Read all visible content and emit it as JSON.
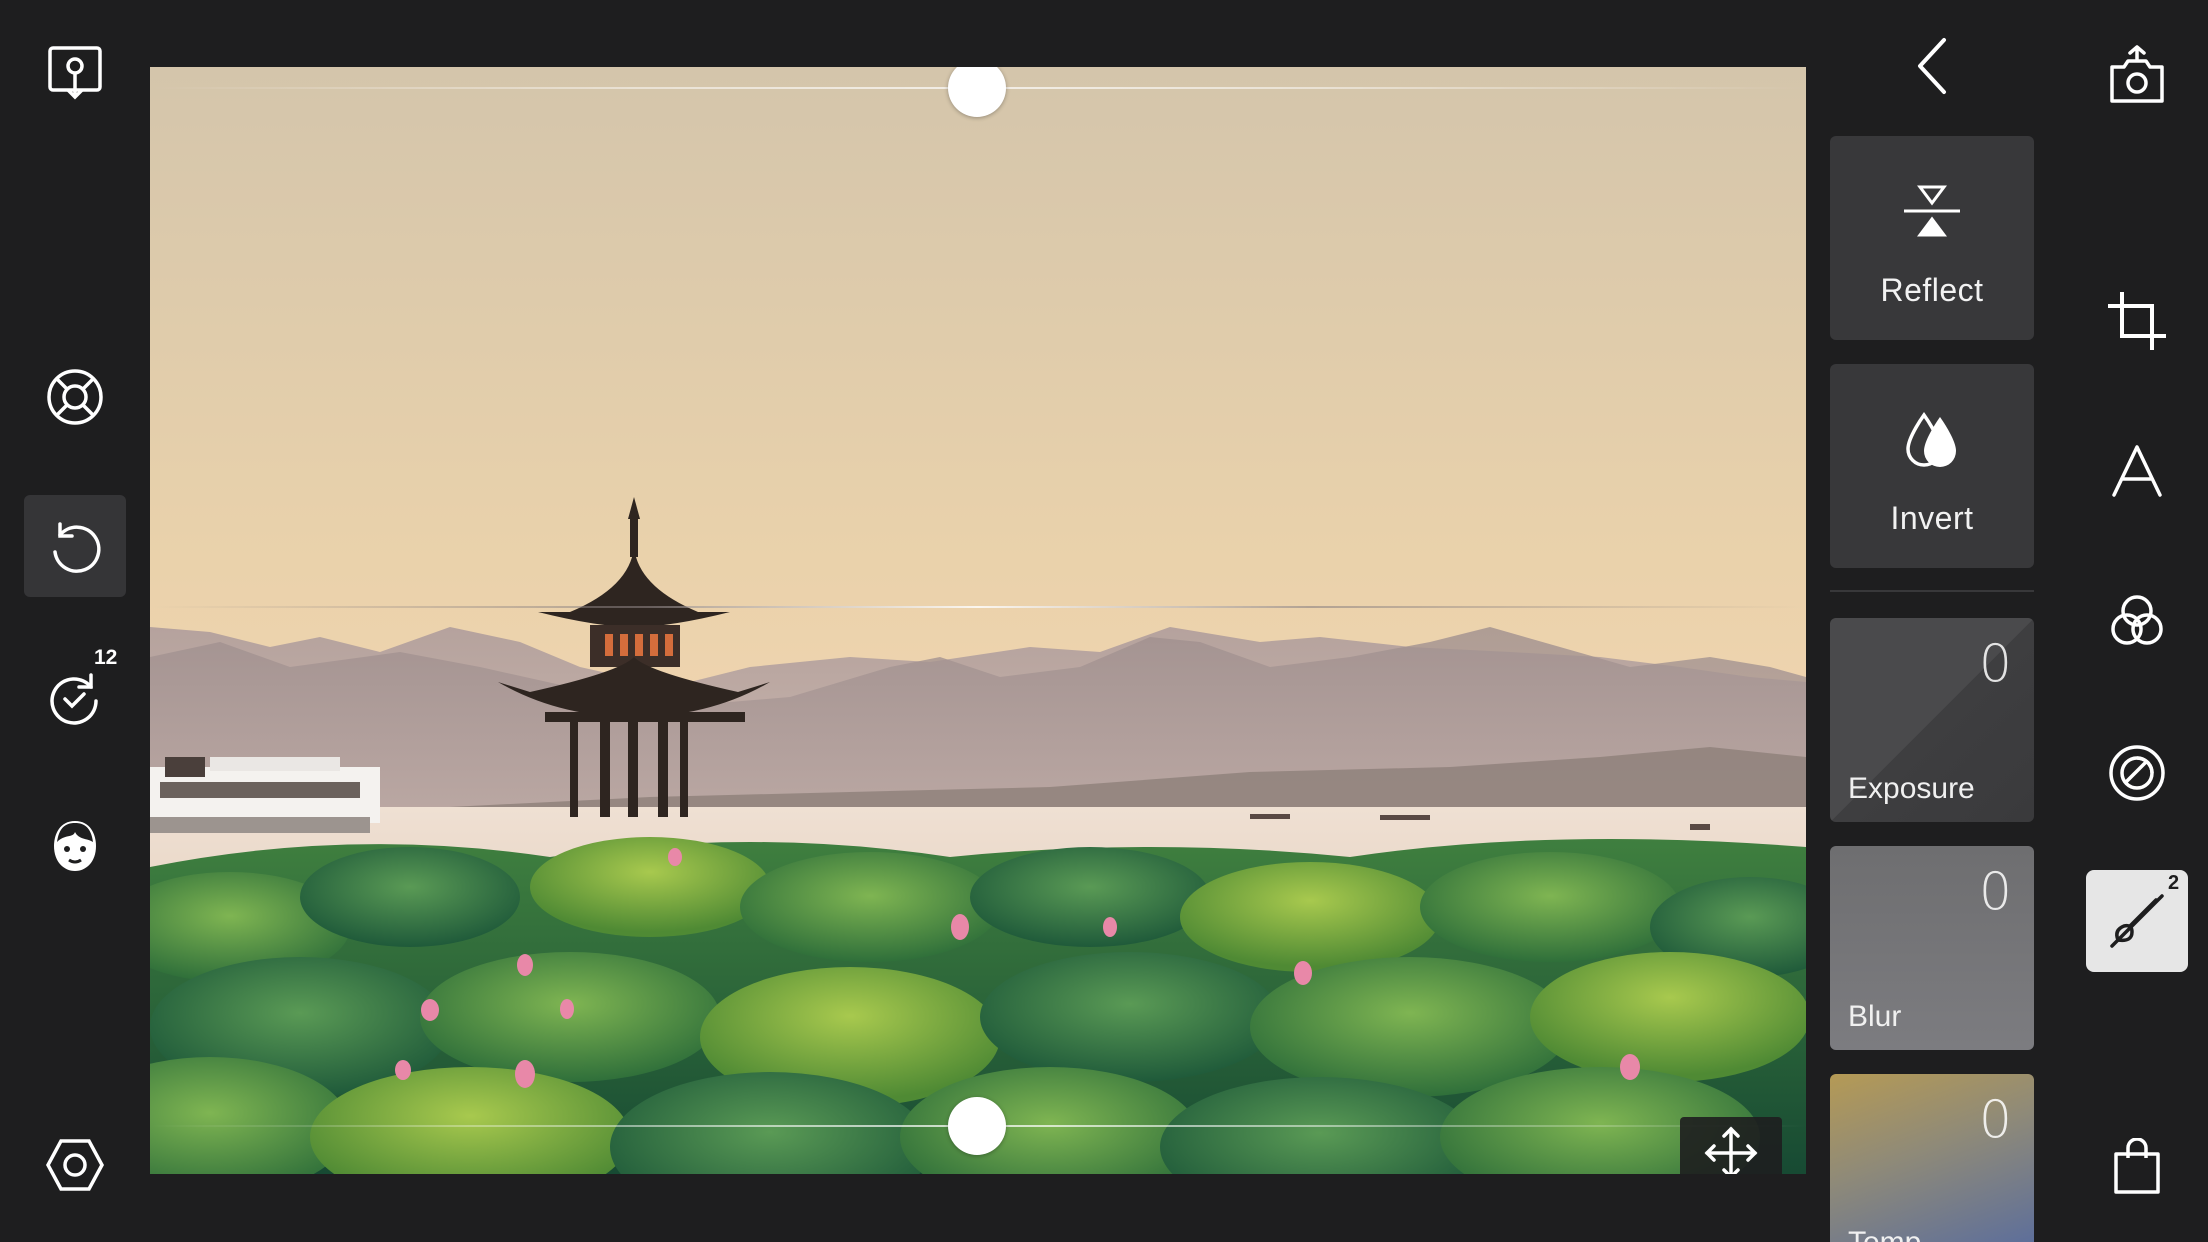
{
  "left_toolbar": {
    "tools": [
      {
        "name": "image-import-icon"
      },
      {
        "name": "lifebuoy-icon"
      },
      {
        "name": "undo-icon"
      },
      {
        "name": "history-icon",
        "badge": "12"
      },
      {
        "name": "face-mask-icon"
      },
      {
        "name": "settings-hexagon-icon"
      }
    ]
  },
  "right_panel": {
    "reflect_label": "Reflect",
    "invert_label": "Invert",
    "sliders": [
      {
        "label": "Exposure",
        "value": "0"
      },
      {
        "label": "Blur",
        "value": "0"
      },
      {
        "label": "Temp",
        "value": "0"
      }
    ]
  },
  "right_toolbar": {
    "tools": [
      {
        "name": "export-camera-icon"
      },
      {
        "name": "crop-icon"
      },
      {
        "name": "text-icon"
      },
      {
        "name": "filters-icon"
      },
      {
        "name": "lens-icon"
      },
      {
        "name": "brush-mask-icon",
        "badge": "2"
      },
      {
        "name": "shopping-bag-icon"
      }
    ]
  },
  "gradient_handles": {
    "top_level": 0.5,
    "bottom_level": 0.5
  },
  "colors": {
    "background": "#1e1e1f",
    "card": "#38383a",
    "active_tool": "#e6e6e6"
  }
}
